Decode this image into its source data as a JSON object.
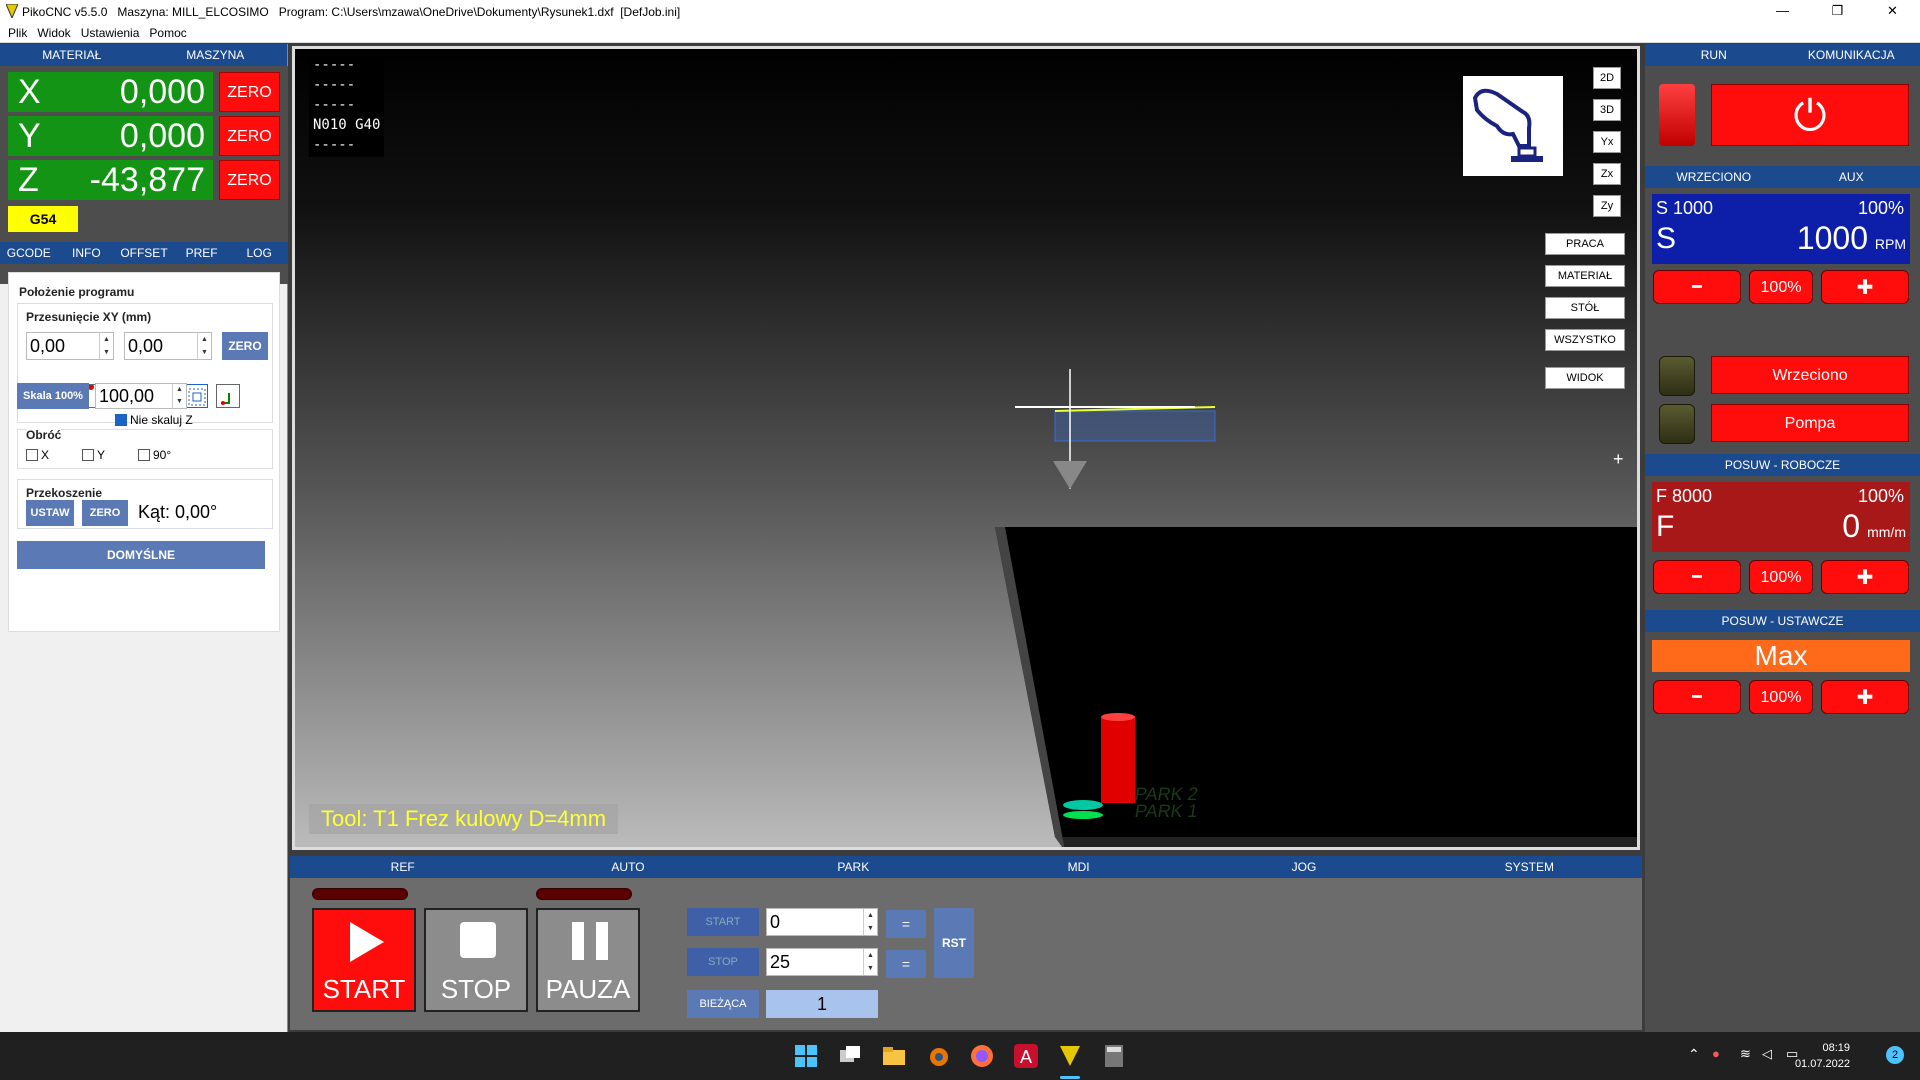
{
  "window": {
    "title": "PikoCNC v5.5.0   Maszyna: MILL_ELCOSIMO   Program: C:\\Users\\mzawa\\OneDrive\\Dokumenty\\Rysunek1.dxf  [DefJob.ini]",
    "minimize": "—",
    "maximize": "❐",
    "close": "✕"
  },
  "menu": [
    "Plik",
    "Widok",
    "Ustawienia",
    "Pomoc"
  ],
  "left": {
    "tabs_top": [
      "MATERIAŁ",
      "MASZYNA"
    ],
    "axes": [
      {
        "label": "X",
        "value": "0,000",
        "zero": "ZERO"
      },
      {
        "label": "Y",
        "value": "0,000",
        "zero": "ZERO"
      },
      {
        "label": "Z",
        "value": "-43,877",
        "zero": "ZERO"
      }
    ],
    "coord_system": "G54",
    "tabs": [
      "GCODE",
      "INFO",
      "OFFSET",
      "PREF",
      "LOG"
    ],
    "program_position": "Położenie programu",
    "offset_xy": "Przesunięcie XY (mm)",
    "offset_x": "0,00",
    "offset_y": "0,00",
    "zero_btn": "ZERO",
    "scale_btn": "Skala 100%",
    "scale_value": "100,00",
    "no_scale_z": "Nie skaluj Z",
    "rotate": "Obróć",
    "rot_x": "X",
    "rot_y": "Y",
    "rot_90": "90°",
    "skew": "Przekoszenie",
    "set_btn": "USTAW",
    "skew_zero": "ZERO",
    "angle": "Kąt: 0,00°",
    "default_btn": "DOMYŚLNE"
  },
  "viewport": {
    "code_lines": "-----\n-----\n-----\nN010 G40\n-----",
    "view_buttons": [
      "2D",
      "3D",
      "Yx",
      "Zx",
      "Zy"
    ],
    "zoom_buttons": [
      "PRACA",
      "MATERIAŁ",
      "STÓŁ",
      "WSZYSTKO"
    ],
    "view_btn": "WIDOK",
    "tool_info": "Tool: T1 Frez kulowy D=4mm",
    "park_labels": [
      "PARK 2",
      "PARK 1"
    ],
    "plus_mark": "+"
  },
  "bottom": {
    "tabs": [
      "REF",
      "AUTO",
      "PARK",
      "MDI",
      "JOG",
      "SYSTEM"
    ],
    "start": "START",
    "stop": "STOP",
    "pause": "PAUZA",
    "start_lbl": "START",
    "stop_lbl": "STOP",
    "start_val": "0",
    "stop_val": "25",
    "eq": "=",
    "rst": "RST",
    "current_lbl": "BIEŻĄCA",
    "current_val": "1"
  },
  "right": {
    "tabs_top": [
      "RUN",
      "KOMUNIKACJA"
    ],
    "power_icon": "⏻",
    "spindle_tabs": [
      "WRZECIONO",
      "AUX"
    ],
    "spindle_set": "S 1000",
    "spindle_pct": "100%",
    "spindle_letter": "S",
    "spindle_val": "1000",
    "spindle_unit": "RPM",
    "minus": "━",
    "plus": "✚",
    "pct": "100%",
    "wrzeciono": "Wrzeciono",
    "pompa": "Pompa",
    "feed_head": "POSUW - ROBOCZE",
    "feed_set": "F 8000",
    "feed_pct": "100%",
    "feed_letter": "F",
    "feed_val": "0",
    "feed_unit": "mm/m",
    "rapid_head": "POSUW - USTAWCZE",
    "rapid_val": "Max"
  },
  "taskbar": {
    "time": "08:19",
    "date": "01.07.2022",
    "notif": "2"
  },
  "colors": {
    "accent": "#1c4a8e",
    "zero_red": "#ff0d0d",
    "dro_green": "#149414",
    "g54_yellow": "#ffff00",
    "spindle_blue": "#0d1fa8",
    "feed_red": "#a81818",
    "rapid_orange": "#ff6a1a"
  }
}
